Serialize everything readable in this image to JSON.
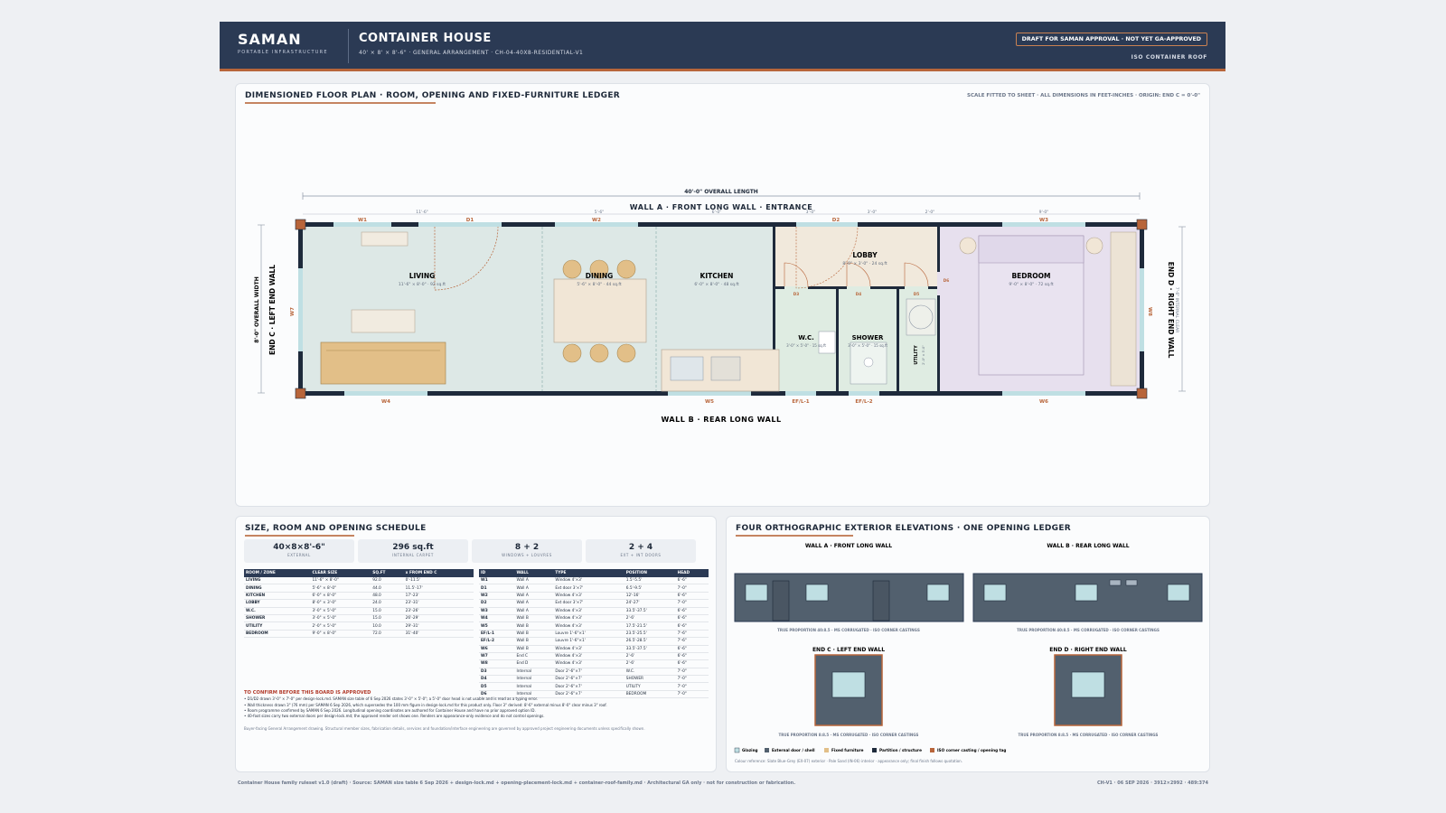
{
  "header": {
    "brand": "SAMAN",
    "brand_sub": "PORTABLE INFRASTRUCTURE",
    "title": "CONTAINER HOUSE",
    "subtitle": "40' × 8' × 8'-6\" · GENERAL ARRANGEMENT · CH-04-40X8-RESIDENTIAL-V1",
    "draft_badge": "DRAFT FOR SAMAN APPROVAL · NOT YET GA-APPROVED",
    "roof": "ISO CONTAINER ROOF"
  },
  "plan": {
    "title": "DIMENSIONED FLOOR PLAN · ROOM, OPENING AND FIXED-FURNITURE LEDGER",
    "scale_note": "SCALE FITTED TO SHEET · ALL DIMENSIONS IN FEET-INCHES · ORIGIN: END C = 0'-0\"",
    "overall_length": "40'-0\" OVERALL LENGTH",
    "wall_a": "WALL A · FRONT LONG WALL · ENTRANCE",
    "wall_b": "WALL B · REAR LONG WALL",
    "end_c": "END C · LEFT END WALL",
    "end_d": "END D · RIGHT END WALL",
    "overall_width": "8'-0\" OVERALL WIDTH",
    "internal_clear": "7'-6\" INTERNAL CLEAR",
    "seg_dims": [
      "11'-6\"",
      "5'-6\"",
      "6'-0\"",
      "3'-0\"",
      "3'-0\"",
      "2'-0\"",
      "9'-0\""
    ],
    "rooms": [
      {
        "name": "LIVING",
        "dims": "11'-6\" × 8'-0\" · 92 sq.ft"
      },
      {
        "name": "DINING",
        "dims": "5'-6\" × 8'-0\" · 44 sq.ft"
      },
      {
        "name": "KITCHEN",
        "dims": "6'-0\" × 8'-0\" · 48 sq.ft"
      },
      {
        "name": "LOBBY",
        "dims": "8'-0\" × 3'-0\" · 24 sq.ft"
      },
      {
        "name": "W.C.",
        "dims": "3'-0\" × 5'-0\" · 15 sq.ft"
      },
      {
        "name": "SHOWER",
        "dims": "3'-0\" × 5'-0\" · 15 sq.ft"
      },
      {
        "name": "UTILITY",
        "dims": "2'-0\" × 5'-0\""
      },
      {
        "name": "BEDROOM",
        "dims": "9'-0\" × 8'-0\" · 72 sq.ft"
      }
    ],
    "tags": {
      "w1": "W1",
      "d1": "D1",
      "w2": "W2",
      "d2": "D2",
      "w3": "W3",
      "w4": "W4",
      "w5": "W5",
      "w6": "W6",
      "w7": "W7",
      "w8": "W8",
      "efl1": "EF/L-1",
      "efl2": "EF/L-2",
      "d3": "D3",
      "d4": "D4",
      "d5": "D5",
      "d6": "D6"
    }
  },
  "schedule": {
    "title": "SIZE, ROOM AND OPENING SCHEDULE",
    "stats": [
      {
        "value": "40×8×8'-6\"",
        "label": "EXTERNAL"
      },
      {
        "value": "296 sq.ft",
        "label": "INTERNAL CARPET"
      },
      {
        "value": "8 + 2",
        "label": "WINDOWS + LOUVRES"
      },
      {
        "value": "2 + 4",
        "label": "EXT + INT DOORS"
      }
    ],
    "room_headers": [
      "ROOM / ZONE",
      "CLEAR SIZE",
      "SQ.FT",
      "x FROM END C"
    ],
    "rooms": [
      [
        "LIVING",
        "11'-6\" × 8'-0\"",
        "92.0",
        "0'-11.5'"
      ],
      [
        "DINING",
        "5'-6\" × 8'-0\"",
        "44.0",
        "11.5'-17'"
      ],
      [
        "KITCHEN",
        "6'-0\" × 8'-0\"",
        "48.0",
        "17'-23'"
      ],
      [
        "LOBBY",
        "8'-0\" × 3'-0\"",
        "24.0",
        "23'-31'"
      ],
      [
        "W.C.",
        "3'-0\" × 5'-0\"",
        "15.0",
        "23'-26'"
      ],
      [
        "SHOWER",
        "3'-0\" × 5'-0\"",
        "15.0",
        "26'-29'"
      ],
      [
        "UTILITY",
        "2'-0\" × 5'-0\"",
        "10.0",
        "29'-31'"
      ],
      [
        "BEDROOM",
        "9'-0\" × 8'-0\"",
        "72.0",
        "31'-40'"
      ]
    ],
    "opening_headers": [
      "ID",
      "WALL",
      "TYPE",
      "POSITION",
      "HEAD"
    ],
    "openings": [
      [
        "W1",
        "Wall A",
        "Window 4'×3'",
        "1.5'-5.5'",
        "6'-6\""
      ],
      [
        "D1",
        "Wall A",
        "Ext door 3'×7'",
        "6.5'-9.5'",
        "7'-0\""
      ],
      [
        "W2",
        "Wall A",
        "Window 4'×3'",
        "12'-16'",
        "6'-6\""
      ],
      [
        "D2",
        "Wall A",
        "Ext door 3'×7'",
        "24'-27'",
        "7'-0\""
      ],
      [
        "W3",
        "Wall A",
        "Window 4'×3'",
        "33.5'-37.5'",
        "6'-6\""
      ],
      [
        "W4",
        "Wall B",
        "Window 4'×3'",
        "2'-6'",
        "6'-6\""
      ],
      [
        "W5",
        "Wall B",
        "Window 4'×3'",
        "17.5'-21.5'",
        "6'-6\""
      ],
      [
        "EF/L-1",
        "Wall B",
        "Louvre 1'-6\"×1'",
        "23.5'-25.5'",
        "7'-6\""
      ],
      [
        "EF/L-2",
        "Wall B",
        "Louvre 1'-6\"×1'",
        "26.5'-28.5'",
        "7'-6\""
      ],
      [
        "W6",
        "Wall B",
        "Window 4'×3'",
        "33.5'-37.5'",
        "6'-6\""
      ],
      [
        "W7",
        "End C",
        "Window 4'×3'",
        "2'-6'",
        "6'-6\""
      ],
      [
        "W8",
        "End D",
        "Window 4'×3'",
        "2'-6'",
        "6'-6\""
      ],
      [
        "D3",
        "Internal",
        "Door 2'-6\"×7'",
        "W.C.",
        "7'-0\""
      ],
      [
        "D4",
        "Internal",
        "Door 2'-6\"×7'",
        "SHOWER",
        "7'-0\""
      ],
      [
        "D5",
        "Internal",
        "Door 2'-6\"×7'",
        "UTILITY",
        "7'-0\""
      ],
      [
        "D6",
        "Internal",
        "Door 2'-6\"×7'",
        "BEDROOM",
        "7'-0\""
      ]
    ],
    "confirm_title": "TO CONFIRM BEFORE THIS BOARD IS APPROVED",
    "confirm_lines": [
      "• D1/D2 drawn 3'-0\" × 7'-0\" per design-lock.md. SAMAN size table of 6 Sep 2026 states 3'-0\" × 5'-0\"; a 5'-0\" door head is not usable and is read as a typing error.",
      "• Wall thickness drawn 3\" (76 mm) per SAMAN 6 Sep 2026, which supersedes the 100 mm figure in design-lock.md for this product only. Floor 3\" derived: 8'-6\" external minus 8'-0\" clear minus 3\" roof.",
      "• Room programme confirmed by SAMAN 6 Sep 2026. Longitudinal opening coordinates are authored for Container House and have no prior approved option ID.",
      "• 40-foot sizes carry two external doors per design-lock.md; the approved render set shows one. Renders are appearance-only evidence and do not control openings."
    ],
    "buyer_note": "Buyer-facing General Arrangement drawing. Structural member sizes, fabrication details, services and foundation/interface engineering are governed by approved project engineering documents unless specifically shown."
  },
  "elevations": {
    "title": "FOUR ORTHOGRAPHIC EXTERIOR ELEVATIONS · ONE OPENING LEDGER",
    "wall_a": "WALL A · FRONT LONG WALL",
    "wall_b": "WALL B · REAR LONG WALL",
    "end_c": "END C · LEFT END WALL",
    "end_d": "END D · RIGHT END WALL",
    "prop_long": "TRUE PROPORTION 40:8.5 · MS CORRUGATED · ISO CORNER CASTINGS",
    "prop_end": "TRUE PROPORTION 8:8.5 · MS CORRUGATED · ISO CORNER CASTINGS",
    "legend": [
      "Glazing",
      "External door / shell",
      "Fixed furniture",
      "Partition / structure",
      "ISO corner casting / opening tag"
    ],
    "colour_note": "Colour reference: Slate Blue-Grey (EX-07) exterior · Pale Sand (IN-06) interior · appearance only; final finish follows quotation."
  },
  "footer": {
    "left": "Container House family ruleset v1.0 (draft) · Source: SAMAN size table 6 Sep 2026 + design-lock.md + opening-placement-lock.md + container-roof-family.md · Architectural GA only · not for construction or fabrication.",
    "right": "CH-V1 · 06 SEP 2026 · 3912×2992 · 489:374"
  },
  "colors": {
    "navy": "#2b3a54",
    "accent": "#b8653a",
    "wall": "#1e2a3b",
    "living": "#dde8e6",
    "lobby": "#f1e9dc",
    "wet": "#dfece2",
    "bedroom": "#e7e0ee",
    "cladding": "#52606e",
    "glazing": "#bfdfe3"
  }
}
